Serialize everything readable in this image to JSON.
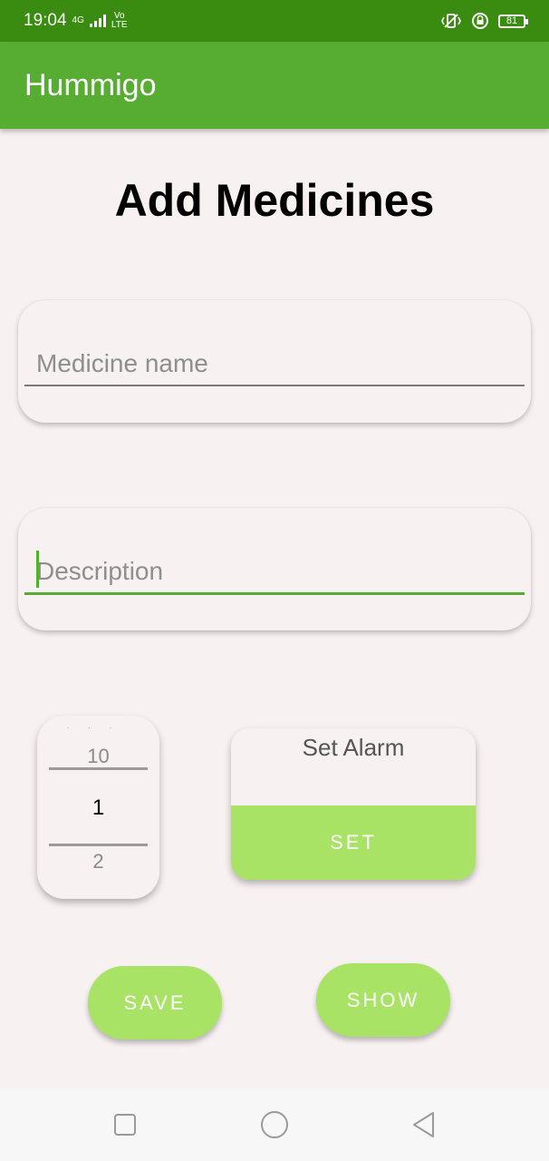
{
  "status_bar": {
    "time": "19:04",
    "network_4g": "4G",
    "volte_top": "Vo",
    "volte_bottom": "LTE",
    "battery": "81"
  },
  "app_bar": {
    "title": "Hummigo"
  },
  "page": {
    "title": "Add Medicines"
  },
  "medicine_name": {
    "placeholder": "Medicine name",
    "value": ""
  },
  "description": {
    "placeholder": "Description",
    "value": ""
  },
  "picker": {
    "previous": "10",
    "current": "1",
    "next": "2"
  },
  "alarm": {
    "label": "Set Alarm",
    "button": "SET"
  },
  "actions": {
    "save": "SAVE",
    "show": "SHOW"
  },
  "icons": {
    "nav_recents": "square-icon",
    "nav_home": "circle-icon",
    "nav_back": "triangle-back-icon"
  },
  "colors": {
    "status_bar": "#3a8c11",
    "app_bar": "#57ad31",
    "button": "#a8e366",
    "background": "#f8f1f1"
  }
}
